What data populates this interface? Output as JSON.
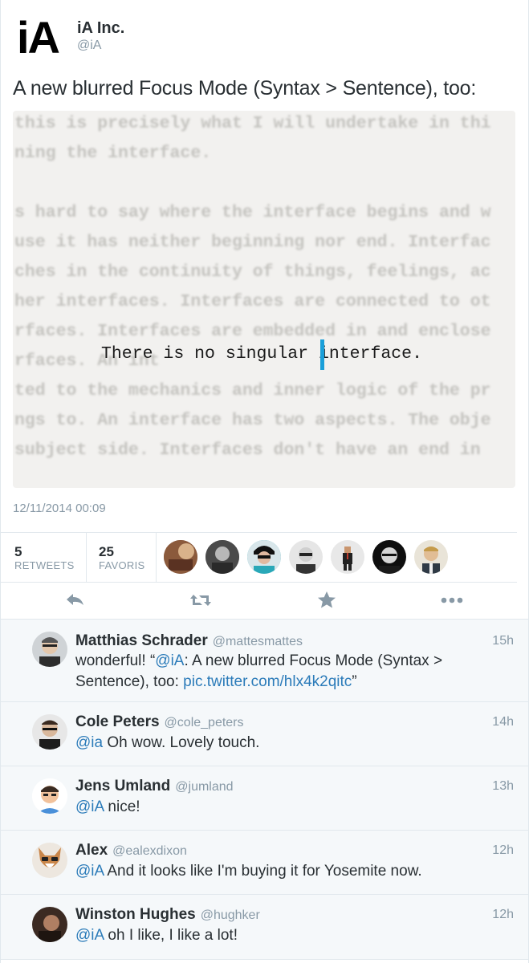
{
  "account": {
    "logo": "iA",
    "name": "iA Inc.",
    "handle": "@iA"
  },
  "tweet": {
    "text": "A new blurred Focus Mode (Syntax > Sentence), too:",
    "timestamp": "12/11/2014 00:09"
  },
  "media": {
    "lines": [
      "this is precisely what I will undertake in thi",
      "ning the interface.",
      "",
      "s hard to say where the interface begins and w",
      "use it has neither beginning nor end. Interfac",
      "ches in the continuity of things, feelings, ac",
      "her interfaces. Interfaces are connected to ot",
      "rfaces. Interfaces are embedded in and enclose",
      "rfaces.                                 An int",
      "ted to the mechanics and inner logic of the pr",
      "ngs to. An interface has two aspects. The obje",
      "subject side. Interfaces don't have an end in "
    ],
    "focus_before": "There is no singular",
    "focus_after": " interface.",
    "cursor_color": "#1a9fd9"
  },
  "stats": {
    "retweets": {
      "count": "5",
      "label": "RETWEETS"
    },
    "favorites": {
      "count": "25",
      "label": "FAVORIS"
    }
  },
  "actions": [
    "reply-icon",
    "retweet-icon",
    "favorite-icon",
    "more-icon"
  ],
  "replies": [
    {
      "name": "Matthias Schrader",
      "handle": "@mattesmattes",
      "time": "15h",
      "pre": "wonderful! “",
      "mention": "@iA",
      "mid": ": A new blurred Focus Mode (Syntax > Sentence), too: ",
      "link": "pic.twitter.com/hlx4k2qitc",
      "post": "”"
    },
    {
      "name": "Cole Peters",
      "handle": "@cole_peters",
      "time": "14h",
      "mention": "@ia",
      "text": " Oh wow. Lovely touch."
    },
    {
      "name": "Jens Umland",
      "handle": "@jumland",
      "time": "13h",
      "mention": "@iA",
      "text": " nice!"
    },
    {
      "name": "Alex",
      "handle": "@ealexdixon",
      "time": "12h",
      "mention": "@iA",
      "text": " And it looks like I'm buying it for Yosemite now."
    },
    {
      "name": "Winston Hughes",
      "handle": "@hughker",
      "time": "12h",
      "mention": "@iA",
      "text": " oh I like, I like a lot!"
    }
  ],
  "colors": {
    "link": "#2b7bb9",
    "muted": "#8899a6",
    "text": "#292f33",
    "accent": "#1a9fd9"
  }
}
